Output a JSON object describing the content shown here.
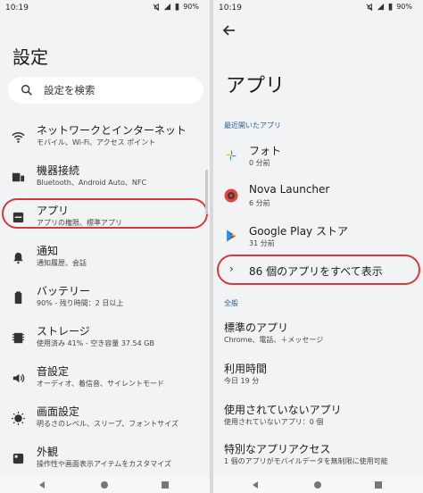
{
  "status": {
    "time": "10:19",
    "battery": "90%"
  },
  "left": {
    "title": "設定",
    "search_placeholder": "設定を検索",
    "items": [
      {
        "title": "ネットワークとインターネット",
        "sub": "モバイル、Wi-Fi、アクセス ポイント",
        "icon": "wifi-icon"
      },
      {
        "title": "機器接続",
        "sub": "Bluetooth、Android Auto、NFC",
        "icon": "devices-icon"
      },
      {
        "title": "アプリ",
        "sub": "アプリの権限、標準アプリ",
        "icon": "apps-icon"
      },
      {
        "title": "通知",
        "sub": "通知履歴、会話",
        "icon": "bell-icon"
      },
      {
        "title": "バッテリー",
        "sub": "90% - 残り時間：2 日以上",
        "icon": "battery-icon"
      },
      {
        "title": "ストレージ",
        "sub": "使用済み 41% - 空き容量 37.54 GB",
        "icon": "storage-icon"
      },
      {
        "title": "音設定",
        "sub": "オーディオ、着信音、サイレントモード",
        "icon": "volume-icon"
      },
      {
        "title": "画面設定",
        "sub": "明るさのレベル、スリープ、フォントサイズ",
        "icon": "display-icon"
      },
      {
        "title": "外観",
        "sub": "操作性や画面表示アイテムをカスタマイズ",
        "icon": "palette-icon"
      }
    ]
  },
  "right": {
    "title": "アプリ",
    "recent_header": "最近開いたアプリ",
    "recent": [
      {
        "name": "フォト",
        "time": "0 分前",
        "icon": "google-photos-icon",
        "color": "#f4b400"
      },
      {
        "name": "Nova Launcher",
        "time": "6 分前",
        "icon": "nova-launcher-icon",
        "color": "#e0463a"
      },
      {
        "name": "Google Play ストア",
        "time": "31 分前",
        "icon": "play-store-icon",
        "color": "#01875f"
      }
    ],
    "see_all": "86 個のアプリをすべて表示",
    "general_header": "全般",
    "general": [
      {
        "title": "標準のアプリ",
        "sub": "Chrome、電話、＋メッセージ"
      },
      {
        "title": "利用時間",
        "sub": "今日 19 分"
      },
      {
        "title": "使用されていないアプリ",
        "sub": "使用されていないアプリ：0 個"
      },
      {
        "title": "特別なアプリアクセス",
        "sub": "1 個のアプリがモバイルデータを無制限に使用可能"
      }
    ]
  },
  "colors": {
    "highlight": "#d9383a",
    "section": "#2e5c8a",
    "background": "#f1f3f5"
  }
}
